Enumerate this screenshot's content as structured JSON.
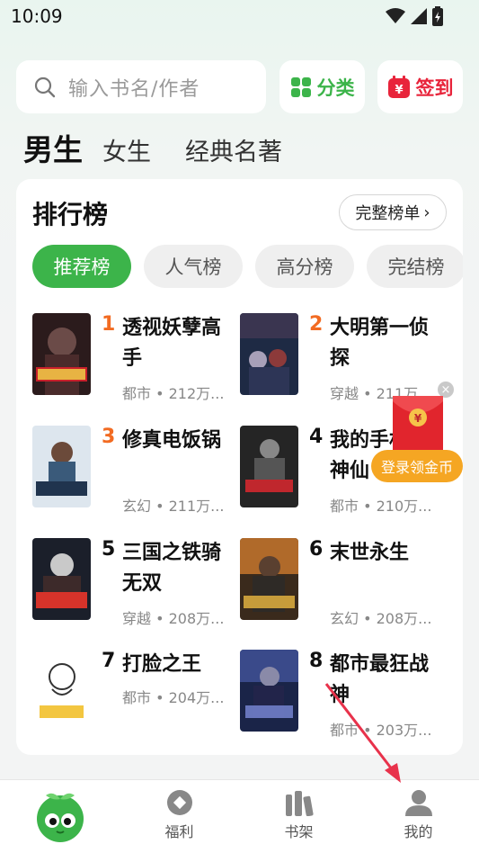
{
  "status": {
    "time": "10:09"
  },
  "search": {
    "placeholder": "输入书名/作者"
  },
  "actions": {
    "category_label": "分类",
    "signin_label": "签到"
  },
  "gender_tabs": [
    "男生",
    "女生",
    "经典名著"
  ],
  "ranking": {
    "title": "排行榜",
    "full_list_label": "完整榜单",
    "tabs": [
      "推荐榜",
      "人气榜",
      "高分榜",
      "完结榜"
    ],
    "books": [
      {
        "rank": "1",
        "title": "透视妖孽高手",
        "meta": "都市 • 212万..."
      },
      {
        "rank": "2",
        "title": "大明第一侦探",
        "meta": "穿越 • 211万..."
      },
      {
        "rank": "3",
        "title": "修真电饭锅",
        "meta": "玄幻 • 211万..."
      },
      {
        "rank": "4",
        "title": "我的手机通神仙",
        "meta": "都市 • 210万..."
      },
      {
        "rank": "5",
        "title": "三国之铁骑无双",
        "meta": "穿越 • 208万..."
      },
      {
        "rank": "6",
        "title": "末世永生",
        "meta": "玄幻 • 208万..."
      },
      {
        "rank": "7",
        "title": "打脸之王",
        "meta": "都市 • 204万..."
      },
      {
        "rank": "8",
        "title": "都市最狂战神",
        "meta": "都市 • 203万..."
      }
    ]
  },
  "popup": {
    "coin_banner": "登录领金币",
    "close": "×"
  },
  "bottom_nav": {
    "welfare": "福利",
    "bookshelf": "书架",
    "mine": "我的"
  },
  "colors": {
    "accent_green": "#3cb44a",
    "rank_orange": "#f26b22",
    "signin_red": "#e8243b",
    "banner_orange": "#f5a623"
  }
}
